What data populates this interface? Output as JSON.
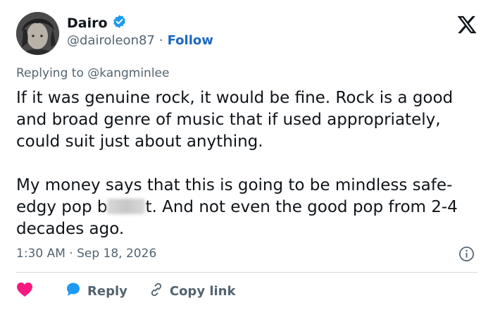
{
  "author": {
    "display_name": "Dairo",
    "handle": "@dairoleon87",
    "separator": "·",
    "follow_label": "Follow"
  },
  "reply_context": {
    "prefix": "Replying to ",
    "mention": "@kangminlee"
  },
  "tweet": {
    "paragraph_1": "If it was genuine rock, it would be fine. Rock is a good and broad genre of music that if used appropriately, could suit just about anything.",
    "paragraph_2_before": "My money says that this is going to be mindless safe-edgy pop b",
    "paragraph_2_after": "t. And not even the good pop from 2-4 decades ago."
  },
  "meta": {
    "time": "1:30 AM",
    "separator": "·",
    "date": "Sep 18, 2026"
  },
  "actions": {
    "reply_label": "Reply",
    "copy_link_label": "Copy link"
  },
  "colors": {
    "verified_blue": "#1d9bf0",
    "link_blue": "#1d68c0",
    "heart_pink": "#f91880",
    "text_primary": "#0f1419",
    "text_secondary": "#536471"
  },
  "icons": [
    "verified-badge-icon",
    "x-logo-icon",
    "info-icon",
    "heart-icon",
    "reply-bubble-icon",
    "link-icon"
  ]
}
